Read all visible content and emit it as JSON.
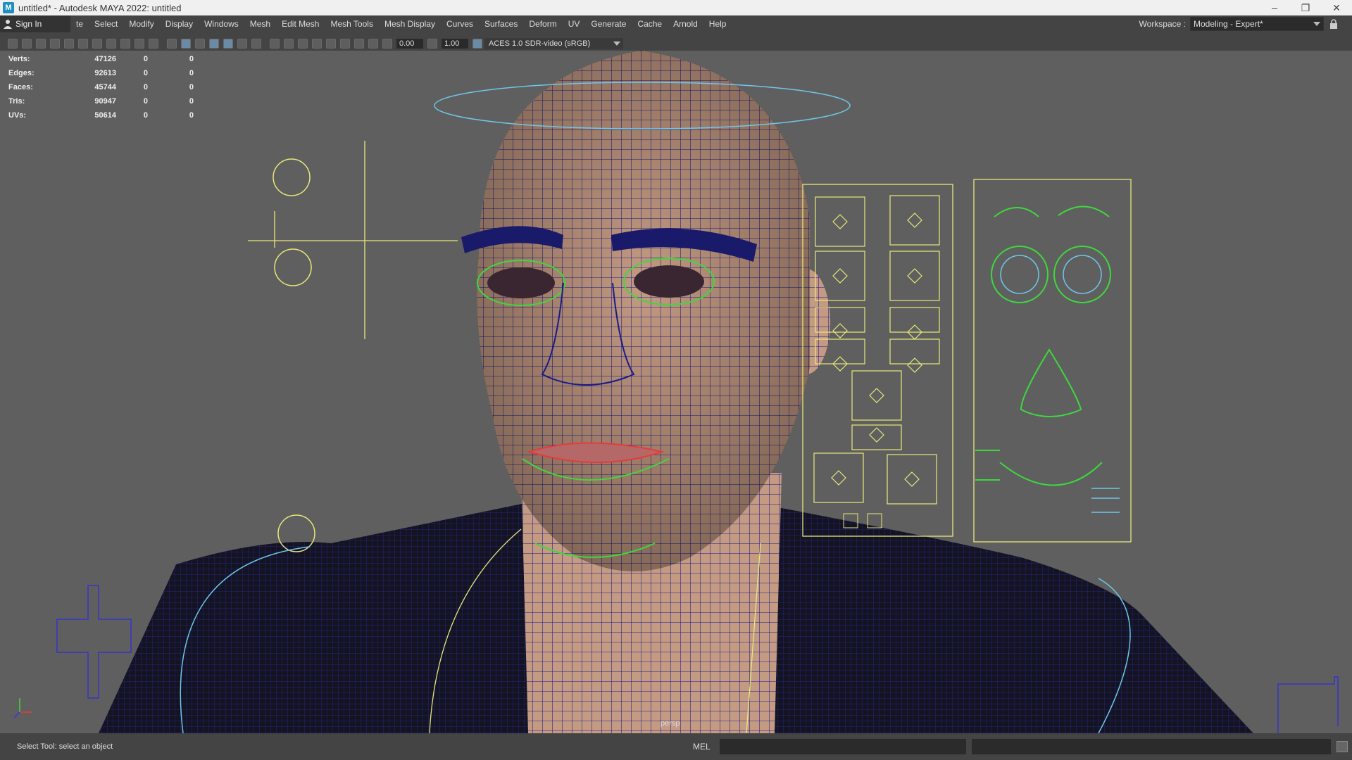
{
  "window": {
    "title": "untitled* - Autodesk MAYA 2022: untitled",
    "app_icon": "maya-logo",
    "controls": [
      "minimize-icon",
      "restore-icon",
      "close-icon"
    ]
  },
  "menubar": {
    "sign_in": "Sign In",
    "items": [
      "te",
      "Select",
      "Modify",
      "Display",
      "Windows",
      "Mesh",
      "Edit Mesh",
      "Mesh Tools",
      "Mesh Display",
      "Curves",
      "Surfaces",
      "Deform",
      "UV",
      "Generate",
      "Cache",
      "Arnold",
      "Help"
    ],
    "workspace_label": "Workspace :",
    "workspace_value": "Modeling - Expert*"
  },
  "toolbar": {
    "exposure": "0.00",
    "gamma": "1.00",
    "color_management": "ACES 1.0 SDR-video (sRGB)"
  },
  "hud": {
    "rows": [
      {
        "label": "Verts:",
        "v1": "47126",
        "v2": "0",
        "v3": "0"
      },
      {
        "label": "Edges:",
        "v1": "92613",
        "v2": "0",
        "v3": "0"
      },
      {
        "label": "Faces:",
        "v1": "45744",
        "v2": "0",
        "v3": "0"
      },
      {
        "label": "Tris:",
        "v1": "90947",
        "v2": "0",
        "v3": "0"
      },
      {
        "label": "UVs:",
        "v1": "50614",
        "v2": "0",
        "v3": "0"
      }
    ]
  },
  "viewport": {
    "camera": "persp"
  },
  "helpline": {
    "text": "Select Tool: select an object",
    "mel_label": "MEL"
  },
  "colors": {
    "wire": "#1a1a8c",
    "rig_yellow": "#e8e87a",
    "rig_green": "#3ed83e",
    "rig_cyan": "#6fc7e8",
    "rig_red": "#e83a3a",
    "skin": "#c49a82"
  }
}
